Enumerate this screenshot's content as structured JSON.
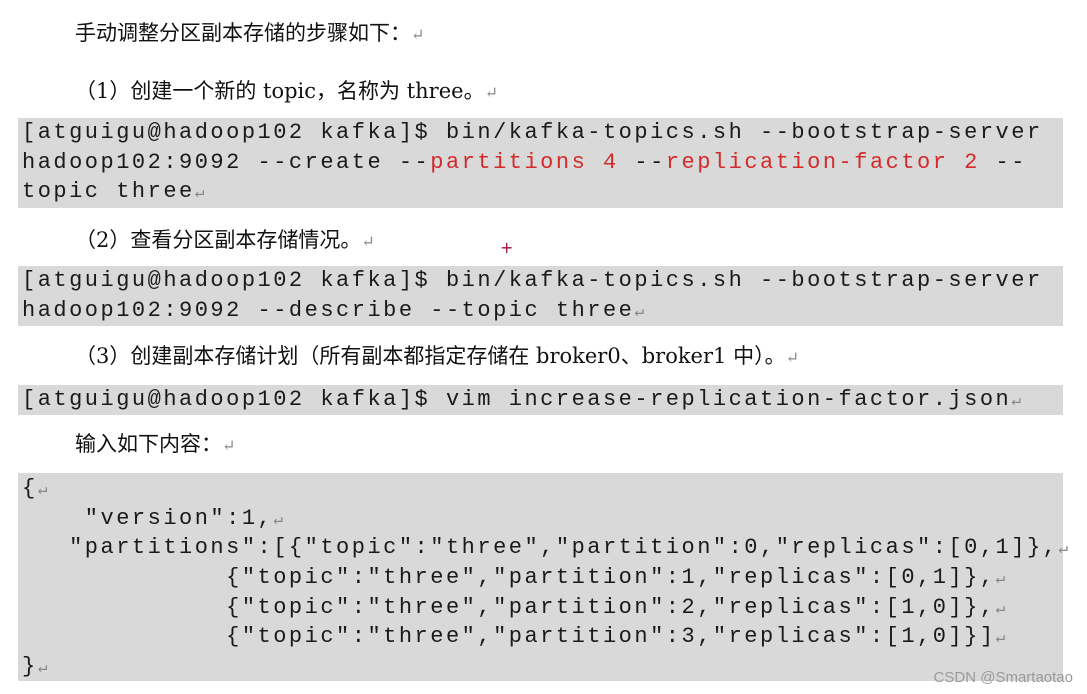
{
  "return_mark": "↵",
  "paragraphs": {
    "intro": "手动调整分区副本存储的步骤如下：",
    "step1": "（1）创建一个新的 topic，名称为 three。",
    "step2": "（2）查看分区副本存储情况。",
    "step3": "（3）创建副本存储计划（所有副本都指定存储在 broker0、broker1 中）。",
    "input": "输入如下内容："
  },
  "code1": {
    "line1": "[atguigu@hadoop102 kafka]$ bin/kafka-topics.sh --bootstrap-server",
    "line2_a": "hadoop102:9092 --create --",
    "line2_b": "partitions 4",
    "line2_c": " --",
    "line2_d": "replication-factor 2",
    "line2_e": " --",
    "line3": "topic three"
  },
  "code2": {
    "line1": "[atguigu@hadoop102 kafka]$ bin/kafka-topics.sh --bootstrap-server",
    "line2": "hadoop102:9092 --describe --topic three"
  },
  "code3": {
    "line1": "[atguigu@hadoop102 kafka]$ vim increase-replication-factor.json"
  },
  "code4": {
    "lines": [
      "{",
      "    \"version\":1,",
      "   \"partitions\":[{\"topic\":\"three\",\"partition\":0,\"replicas\":[0,1]},",
      "             {\"topic\":\"three\",\"partition\":1,\"replicas\":[0,1]},",
      "             {\"topic\":\"three\",\"partition\":2,\"replicas\":[1,0]},",
      "             {\"topic\":\"three\",\"partition\":3,\"replicas\":[1,0]}]",
      "}"
    ]
  },
  "watermark": "CSDN @Smartaotao",
  "colors": {
    "code_bg": "#d9d9d9",
    "highlight": "#d42a2a"
  }
}
